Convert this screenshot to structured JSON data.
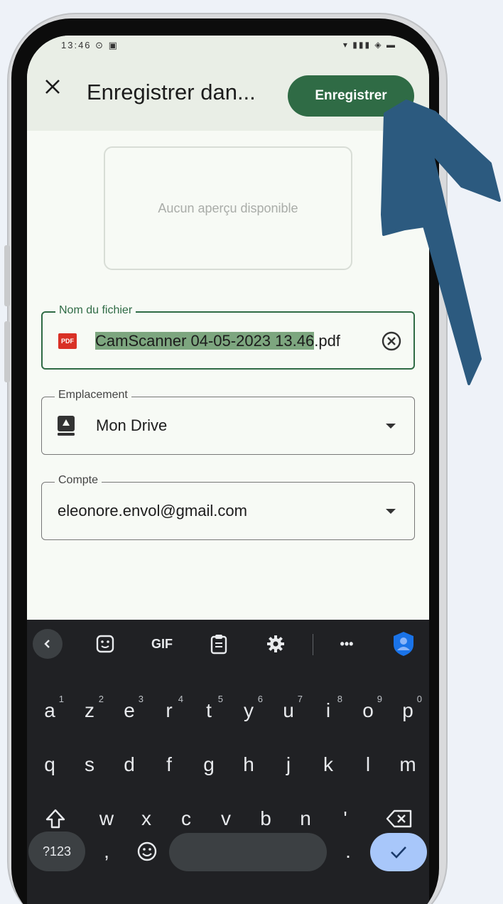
{
  "status_bar": {
    "left": "13:46 ⊙ ▣",
    "right": "▾ ▮▮▮ ◈ ▬"
  },
  "header": {
    "title": "Enregistrer dan...",
    "save_label": "Enregistrer",
    "close_icon": "close-icon"
  },
  "preview": {
    "text": "Aucun aperçu disponible"
  },
  "fields": {
    "filename": {
      "label": "Nom du fichier",
      "selected_part": "CamScanner 04-05-2023 13.46",
      "unselected_part": ".pdf",
      "icon_text": "PDF"
    },
    "location": {
      "label": "Emplacement",
      "value": "Mon Drive"
    },
    "account": {
      "label": "Compte",
      "value": "eleonore.envol@gmail.com"
    }
  },
  "keyboard": {
    "toolbar": [
      "back-icon",
      "sticker-icon",
      "GIF",
      "clipboard-icon",
      "settings-icon",
      "more-icon",
      "account-icon"
    ],
    "gif_label": "GIF",
    "more_label": "•••",
    "row1": [
      [
        "a",
        "1"
      ],
      [
        "z",
        "2"
      ],
      [
        "e",
        "3"
      ],
      [
        "r",
        "4"
      ],
      [
        "t",
        "5"
      ],
      [
        "y",
        "6"
      ],
      [
        "u",
        "7"
      ],
      [
        "i",
        "8"
      ],
      [
        "o",
        "9"
      ],
      [
        "p",
        "0"
      ]
    ],
    "row2": [
      "q",
      "s",
      "d",
      "f",
      "g",
      "h",
      "j",
      "k",
      "l",
      "m"
    ],
    "row3": [
      "w",
      "x",
      "c",
      "v",
      "b",
      "n",
      "'"
    ],
    "symbols_label": "?123",
    "comma": ",",
    "period": "."
  },
  "colors": {
    "accent": "#2f6b45",
    "arrow": "#2c5a7f",
    "selection": "#7da67f",
    "keyboard_bg": "#202124",
    "enter_key": "#a8c7fa"
  }
}
